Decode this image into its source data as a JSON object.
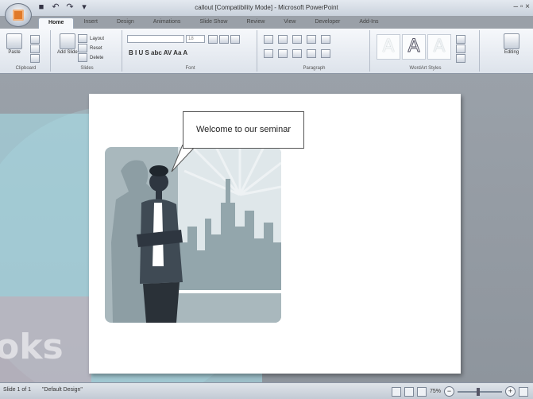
{
  "window": {
    "title": "callout [Compatibility Mode] - Microsoft PowerPoint",
    "controls": "– ▫ ×"
  },
  "tabs": [
    "Home",
    "Insert",
    "Design",
    "Animations",
    "Slide Show",
    "Review",
    "View",
    "Developer",
    "Add-Ins"
  ],
  "ribbon": {
    "clipboard": {
      "label": "Clipboard",
      "paste": "Paste"
    },
    "slides": {
      "label": "Slides",
      "add": "Add Slide",
      "layout": "Layout",
      "reset": "Reset",
      "delete": "Delete"
    },
    "font": {
      "label": "Font",
      "size": "18",
      "format_buttons": "B  I  U  S  abc  AV  Aa  A"
    },
    "paragraph": {
      "label": "Paragraph"
    },
    "wordart": {
      "label": "WordArt Styles",
      "sample": "A"
    },
    "editing": {
      "label": "Editing"
    }
  },
  "slide": {
    "callout_text": "Welcome to our seminar"
  },
  "workspace": {
    "watermark": "oks"
  },
  "status": {
    "slide": "Slide 1 of 1",
    "theme": "\"Default Design\"",
    "zoom": "75%"
  },
  "colors": {
    "accent": "#e07a2a",
    "illustration_bg": "#a9b8bd",
    "figure_dark": "#2e3640"
  }
}
